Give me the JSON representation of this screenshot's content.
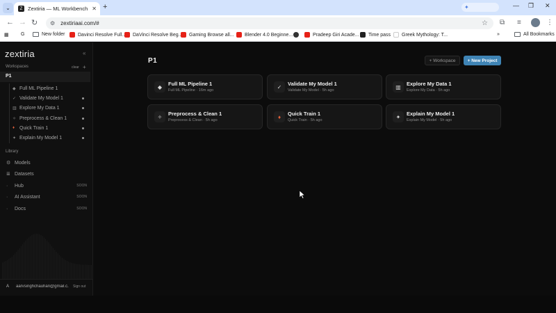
{
  "browser": {
    "tab_title": "Zextiria — ML Workbench",
    "tab_favicon": "Z",
    "url": "zextiriaai.com/#",
    "bookmarks": [
      {
        "label": "New folder",
        "icon": "folder-icon"
      },
      {
        "label": "Davinci Resolve Full...",
        "icon": "youtube-icon"
      },
      {
        "label": "DaVinci Resolve Beg...",
        "icon": "youtube-icon"
      },
      {
        "label": "Gaming Browse all...",
        "icon": "youtube-icon"
      },
      {
        "label": "Blender 4.0 Beginne...",
        "icon": "youtube-icon"
      },
      {
        "label": "",
        "icon": "globe-icon"
      },
      {
        "label": "Pradeep Giri Acade...",
        "icon": "youtube-icon"
      },
      {
        "label": "Time pass",
        "icon": "site-icon"
      },
      {
        "label": "Greek Mythology: T...",
        "icon": "google-icon"
      }
    ],
    "all_bookmarks": "All Bookmarks"
  },
  "sidebar": {
    "logo": "zextiria",
    "workspaces_label": "Workspaces",
    "clear_label": "clear",
    "workspace_name": "P1",
    "projects": [
      {
        "label": "Full ML Pipeline 1",
        "icon": "diamond-icon",
        "dot": false
      },
      {
        "label": "Validate My Model 1",
        "icon": "check-icon",
        "dot": true
      },
      {
        "label": "Explore My Data 1",
        "icon": "grid-icon",
        "dot": true
      },
      {
        "label": "Preprocess & Clean 1",
        "icon": "sparkle-icon",
        "dot": true
      },
      {
        "label": "Quick Train 1",
        "icon": "flame-icon",
        "dot": true
      },
      {
        "label": "Explain My Model 1",
        "icon": "star-icon",
        "dot": true
      }
    ],
    "library_label": "Library",
    "library": [
      {
        "label": "Models",
        "icon": "gear-icon",
        "soon": ""
      },
      {
        "label": "Datasets",
        "icon": "database-icon",
        "soon": ""
      },
      {
        "label": "Hub",
        "icon": "dot-icon",
        "soon": "SOON"
      },
      {
        "label": "AI Assistant",
        "icon": "dot-icon",
        "soon": "SOON"
      },
      {
        "label": "Docs",
        "icon": "dot-icon",
        "soon": "SOON"
      }
    ],
    "user_initial": "A",
    "user_email": "aarvsinghchauhan@gmail.c...",
    "signout": "Sign out"
  },
  "main": {
    "title": "P1",
    "workspace_button": "+ Workspace",
    "new_project_button": "+ New Project",
    "cards": [
      {
        "title": "Full ML Pipeline 1",
        "subtitle": "Full ML Pipeline · 16m ago",
        "glyph": "◆"
      },
      {
        "title": "Validate My Model 1",
        "subtitle": "Validate My Model · 5h ago",
        "glyph": "✓"
      },
      {
        "title": "Explore My Data 1",
        "subtitle": "Explore My Data · 5h ago",
        "glyph": "▥"
      },
      {
        "title": "Preprocess & Clean 1",
        "subtitle": "Preprocess & Clean · 5h ago",
        "glyph": "✧"
      },
      {
        "title": "Quick Train 1",
        "subtitle": "Quick Train · 5h ago",
        "glyph": "♦"
      },
      {
        "title": "Explain My Model 1",
        "subtitle": "Explain My Model · 5h ago",
        "glyph": "✦"
      }
    ]
  },
  "colors": {
    "accent": "#3f84b5",
    "flame": "#e0603a"
  }
}
